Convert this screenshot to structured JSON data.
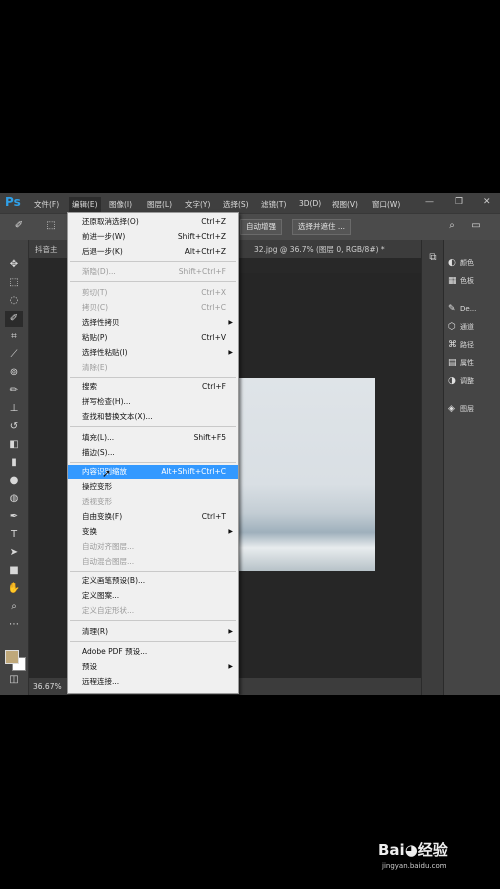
{
  "app": {
    "logo": "Ps"
  },
  "menubar": {
    "items": [
      "文件(F)",
      "编辑(E)",
      "图像(I)",
      "图层(L)",
      "文字(Y)",
      "选择(S)",
      "滤镜(T)",
      "3D(D)",
      "视图(V)",
      "窗口(W)"
    ],
    "active": "编辑(E)"
  },
  "window_controls": {
    "minimize": "—",
    "restore": "❐",
    "close": "✕"
  },
  "options_bar": {
    "auto_enhance": "自动增强",
    "select_and_mask": "选择并遮住 ..."
  },
  "tabs": {
    "left": "抖音主",
    "doc": "32.jpg @ 36.7% (图层 0, RGB/8#) *",
    "close": "×"
  },
  "status": {
    "zoom": "36.67%"
  },
  "right_panels": [
    {
      "icon": "palette-icon",
      "glyph": "◐",
      "label": "颜色"
    },
    {
      "icon": "swatches-icon",
      "glyph": "▦",
      "label": "色板"
    },
    {
      "icon": "brush-preset-icon",
      "glyph": "✎",
      "label": "De..."
    },
    {
      "icon": "paths-icon",
      "glyph": "⬡",
      "label": "通道"
    },
    {
      "icon": "path-icon",
      "glyph": "⌘",
      "label": "路径"
    },
    {
      "icon": "properties-icon",
      "glyph": "▤",
      "label": "属性"
    },
    {
      "icon": "adjustments-icon",
      "glyph": "◑",
      "label": "调整"
    },
    {
      "icon": "layers-icon",
      "glyph": "◈",
      "label": "图层"
    }
  ],
  "edit_menu": {
    "items": [
      {
        "label": "还原取消选择(O)",
        "shortcut": "Ctrl+Z",
        "disabled": false
      },
      {
        "label": "前进一步(W)",
        "shortcut": "Shift+Ctrl+Z",
        "disabled": false
      },
      {
        "label": "后退一步(K)",
        "shortcut": "Alt+Ctrl+Z",
        "disabled": false
      },
      {
        "label": "渐隐(D)...",
        "shortcut": "Shift+Ctrl+F",
        "disabled": true
      },
      {
        "label": "剪切(T)",
        "shortcut": "Ctrl+X",
        "disabled": true
      },
      {
        "label": "拷贝(C)",
        "shortcut": "Ctrl+C",
        "disabled": true
      },
      {
        "label": "选择性拷贝",
        "shortcut": "",
        "disabled": false,
        "submenu": true
      },
      {
        "label": "粘贴(P)",
        "shortcut": "Ctrl+V",
        "disabled": false
      },
      {
        "label": "选择性粘贴(I)",
        "shortcut": "",
        "disabled": false,
        "submenu": true
      },
      {
        "label": "清除(E)",
        "shortcut": "",
        "disabled": true
      },
      {
        "label": "搜索",
        "shortcut": "Ctrl+F",
        "disabled": false
      },
      {
        "label": "拼写检查(H)...",
        "shortcut": "",
        "disabled": false
      },
      {
        "label": "查找和替换文本(X)...",
        "shortcut": "",
        "disabled": false
      },
      {
        "label": "填充(L)...",
        "shortcut": "Shift+F5",
        "disabled": false
      },
      {
        "label": "描边(S)...",
        "shortcut": "",
        "disabled": false
      },
      {
        "label": "内容识别缩放",
        "shortcut": "Alt+Shift+Ctrl+C",
        "disabled": false,
        "highlighted": true
      },
      {
        "label": "操控变形",
        "shortcut": "",
        "disabled": false
      },
      {
        "label": "透视变形",
        "shortcut": "",
        "disabled": true
      },
      {
        "label": "自由变换(F)",
        "shortcut": "Ctrl+T",
        "disabled": false
      },
      {
        "label": "变换",
        "shortcut": "",
        "disabled": false,
        "submenu": true
      },
      {
        "label": "自动对齐图层...",
        "shortcut": "",
        "disabled": true
      },
      {
        "label": "自动混合图层...",
        "shortcut": "",
        "disabled": true
      },
      {
        "label": "定义画笔预设(B)...",
        "shortcut": "",
        "disabled": false
      },
      {
        "label": "定义图案...",
        "shortcut": "",
        "disabled": false
      },
      {
        "label": "定义自定形状...",
        "shortcut": "",
        "disabled": true
      },
      {
        "label": "清理(R)",
        "shortcut": "",
        "disabled": false,
        "submenu": true
      },
      {
        "label": "Adobe PDF 预设...",
        "shortcut": "",
        "disabled": false
      },
      {
        "label": "预设",
        "shortcut": "",
        "disabled": false,
        "submenu": true
      },
      {
        "label": "远程连接...",
        "shortcut": "",
        "disabled": false
      }
    ]
  },
  "tools": [
    "move-tool-icon",
    "marquee-tool-icon",
    "lasso-tool-icon",
    "quick-select-tool-icon",
    "crop-tool-icon",
    "eyedropper-tool-icon",
    "healing-brush-tool-icon",
    "brush-tool-icon",
    "clone-stamp-tool-icon",
    "history-brush-tool-icon",
    "eraser-tool-icon",
    "gradient-tool-icon",
    "blur-tool-icon",
    "dodge-tool-icon",
    "pen-tool-icon",
    "type-tool-icon",
    "path-select-tool-icon",
    "rectangle-tool-icon",
    "hand-tool-icon",
    "zoom-tool-icon",
    "more-tools-icon"
  ],
  "watermark": {
    "logo": "Bai◕经验",
    "site": "jingyan.baidu.com"
  }
}
